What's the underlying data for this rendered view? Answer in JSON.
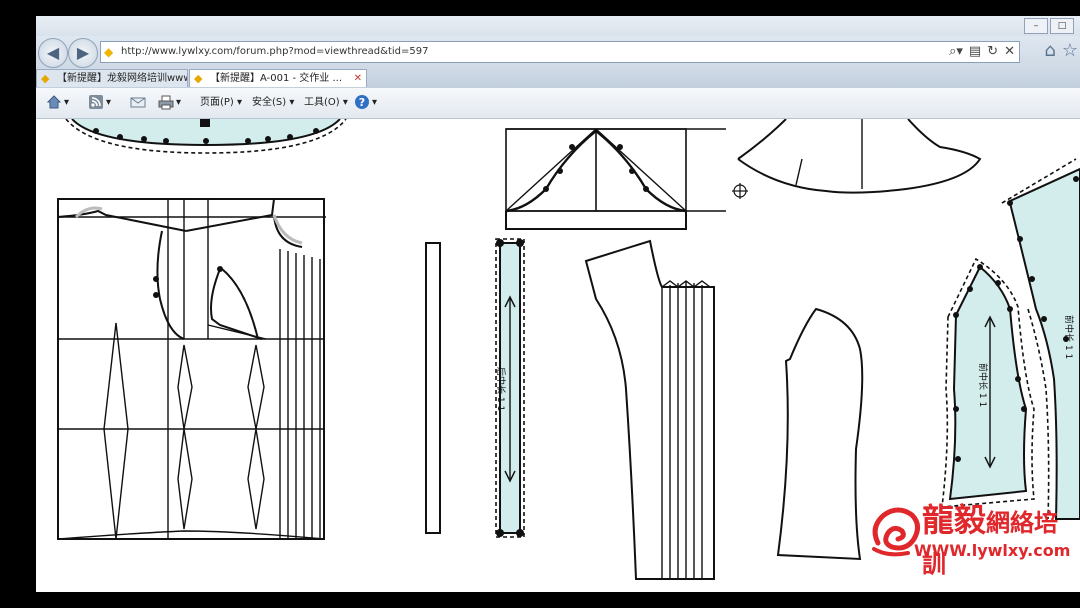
{
  "window": {
    "controls": [
      "–",
      "□"
    ]
  },
  "navigation": {
    "back_icon": "back-arrow-icon",
    "forward_icon": "forward-arrow-icon",
    "url": "http://www.lywlxy.com/forum.php?mod=viewthread&tid=597",
    "address_tools": [
      "⌕▾",
      "▤",
      "↻",
      "✕"
    ],
    "home_icon": "home-icon",
    "favorites_icon": "star-icon"
  },
  "tabs": [
    {
      "label": "【新提醒】龙毅网络培训www....",
      "active": false
    },
    {
      "label": "【新提醒】A-001 - 交作业 ...",
      "active": true,
      "close": "✕"
    }
  ],
  "commandbar": {
    "page_menu": "页面(P) ▾",
    "safety_menu": "安全(S) ▾",
    "tools_menu": "工具(O) ▾",
    "help_icon": "help-icon"
  },
  "drawing": {
    "dimension_left": "后中长 1 1",
    "dimension_mid": "前中长 1 1",
    "dimension_right": "前中长 1 1"
  },
  "watermark": {
    "text_cn": "龍毅",
    "text_cn_small": "網絡培訓",
    "url": "WWW.lywlxy.com",
    "colors": {
      "brand": "#e0272b",
      "pattern_fill": "#d3eded"
    }
  }
}
